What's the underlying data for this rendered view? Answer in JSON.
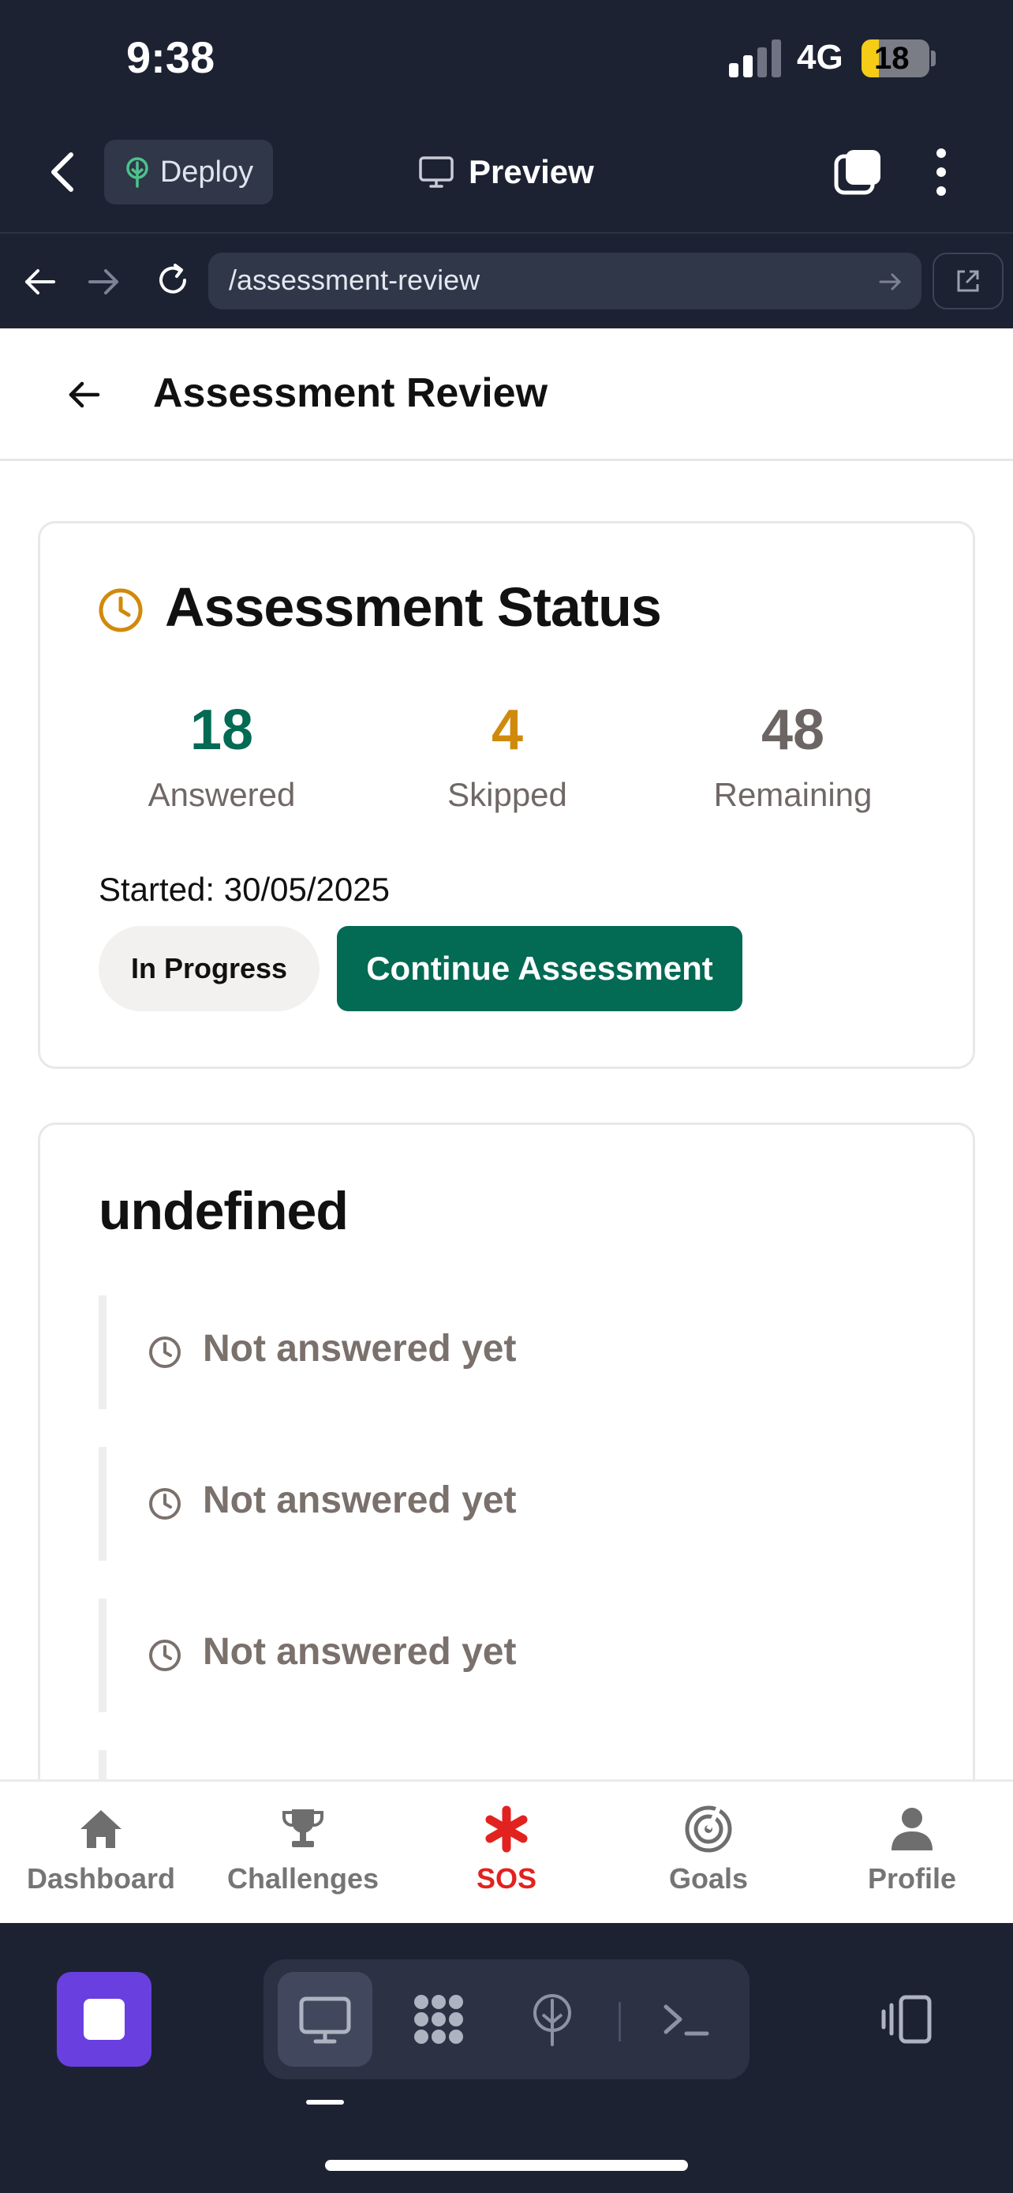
{
  "status_bar": {
    "time": "9:38",
    "network": "4G",
    "battery": "18"
  },
  "toolbar": {
    "deploy_label": "Deploy",
    "preview_label": "Preview"
  },
  "browser": {
    "url": "/assessment-review"
  },
  "page": {
    "title": "Assessment Review"
  },
  "status_card": {
    "title": "Assessment Status",
    "stats": [
      {
        "value": "18",
        "label": "Answered",
        "color": "#036a54"
      },
      {
        "value": "4",
        "label": "Skipped",
        "color": "#d08a0b"
      },
      {
        "value": "48",
        "label": "Remaining",
        "color": "#6b6563"
      }
    ],
    "started": "Started: 30/05/2025",
    "badge": "In Progress",
    "continue_label": "Continue Assessment"
  },
  "question_card": {
    "title": "undefined",
    "items": [
      {
        "text": "Not answered yet"
      },
      {
        "text": "Not answered yet"
      },
      {
        "text": "Not answered yet"
      }
    ]
  },
  "bottom_nav": {
    "items": [
      {
        "label": "Dashboard",
        "icon": "home-icon"
      },
      {
        "label": "Challenges",
        "icon": "trophy-icon"
      },
      {
        "label": "SOS",
        "icon": "asterisk-icon",
        "active": true
      },
      {
        "label": "Goals",
        "icon": "target-icon"
      },
      {
        "label": "Profile",
        "icon": "person-icon"
      }
    ]
  },
  "colors": {
    "accent_green": "#036a54",
    "accent_gold": "#d08a0b",
    "sos_red": "#e2221f",
    "dock_purple": "#6a3fe0"
  }
}
